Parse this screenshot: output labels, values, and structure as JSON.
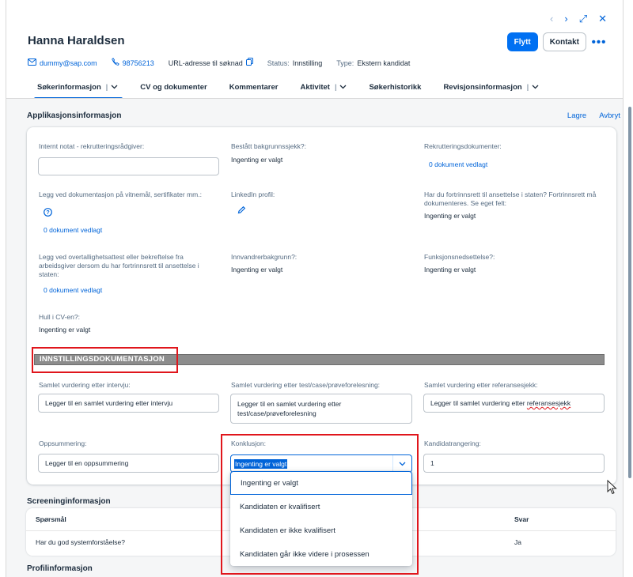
{
  "header": {
    "candidate_name": "Hanna Haraldsen",
    "nav": {
      "prev": "‹",
      "next": "›",
      "expand": "⤢",
      "close": "✕"
    },
    "actions": {
      "move": "Flytt",
      "contact": "Kontakt",
      "more": "•••"
    },
    "meta": {
      "email": "dummy@sap.com",
      "phone": "98756213",
      "application_url": "URL-adresse til søknad",
      "status_label": "Status:",
      "status_value": "Innstilling",
      "type_label": "Type:",
      "type_value": "Ekstern kandidat"
    },
    "tabs": [
      {
        "label": "Søkerinformasjon",
        "active": true,
        "has_menu": true
      },
      {
        "label": "CV og dokumenter"
      },
      {
        "label": "Kommentarer"
      },
      {
        "label": "Aktivitet",
        "has_menu": true
      },
      {
        "label": "Søkerhistorikk"
      },
      {
        "label": "Revisjonsinformasjon",
        "has_menu": true
      }
    ]
  },
  "application_section": {
    "title": "Applikasjonsinformasjon",
    "save": "Lagre",
    "cancel": "Avbryt",
    "fields": {
      "internal_note_label": "Internt notat - rekrutteringsrådgiver:",
      "internal_note_value": "",
      "background_check_label": "Bestått bakgrunnssjekk?:",
      "background_check_value": "Ingenting er valgt",
      "recruitment_docs_label": "Rekrutteringsdokumenter:",
      "recruitment_docs_value": "0 dokument vedlagt",
      "diploma_docs_label": "Legg ved dokumentasjon på vitnemål, sertifikater mm.:",
      "diploma_docs_value": "0 dokument vedlagt",
      "linkedin_label": "LinkedIn profil:",
      "priority_label": "Har du fortrinnsrett til ansettelse i staten? Fortrinnsrett må dokumenteres. Se eget felt:",
      "priority_value": "Ingenting er valgt",
      "redundancy_label": "Legg ved overtallighetsattest eller bekreftelse fra arbeidsgiver dersom du har fortrinnsrett til ansettelse i staten:",
      "redundancy_value": "0 dokument vedlagt",
      "immigrant_label": "Innvandrerbakgrunn?:",
      "immigrant_value": "Ingenting er valgt",
      "disability_label": "Funksjonsnedsettelse?:",
      "disability_value": "Ingenting er valgt",
      "cv_gap_label": "Hull i CV-en?:",
      "cv_gap_value": "Ingenting er valgt"
    },
    "banner": "INNSTILLINGSDOKUMENTASJON",
    "recommendation": {
      "interview_label": "Samlet vurdering etter intervju:",
      "interview_value": "Legger til en samlet vurdering etter intervju",
      "test_label": "Samlet vurdering etter test/case/prøveforelesning:",
      "test_value": "Legger til en samlet vurdering etter test/case/prøveforelesning",
      "reference_label": "Samlet vurdering etter referansesjekk:",
      "reference_value_prefix": "Legger til samlet vurdering etter ",
      "reference_value_flagged": "referansesjekk",
      "summary_label": "Oppsummering:",
      "summary_value": "Legger til en oppsummering",
      "conclusion_label": "Konklusjon:",
      "conclusion_value": "Ingenting er valgt",
      "conclusion_options": [
        "Ingenting er valgt",
        "Kandidaten er kvalifisert",
        "Kandidaten er ikke kvalifisert",
        "Kandidaten går ikke videre i prosessen"
      ],
      "ranking_label": "Kandidatrangering:",
      "ranking_value": "1"
    }
  },
  "screening_section": {
    "title": "Screeninginformasjon",
    "columns": [
      "Spørsmål",
      "Svar"
    ],
    "rows": [
      {
        "question": "Har du god systemforståelse?",
        "answer": "Ja"
      }
    ]
  },
  "profile_section": {
    "title": "Profilinformasjon"
  },
  "colors": {
    "accent": "#0064d9",
    "highlight_red": "#e0161c",
    "banner_gray": "#8c8c8c"
  }
}
